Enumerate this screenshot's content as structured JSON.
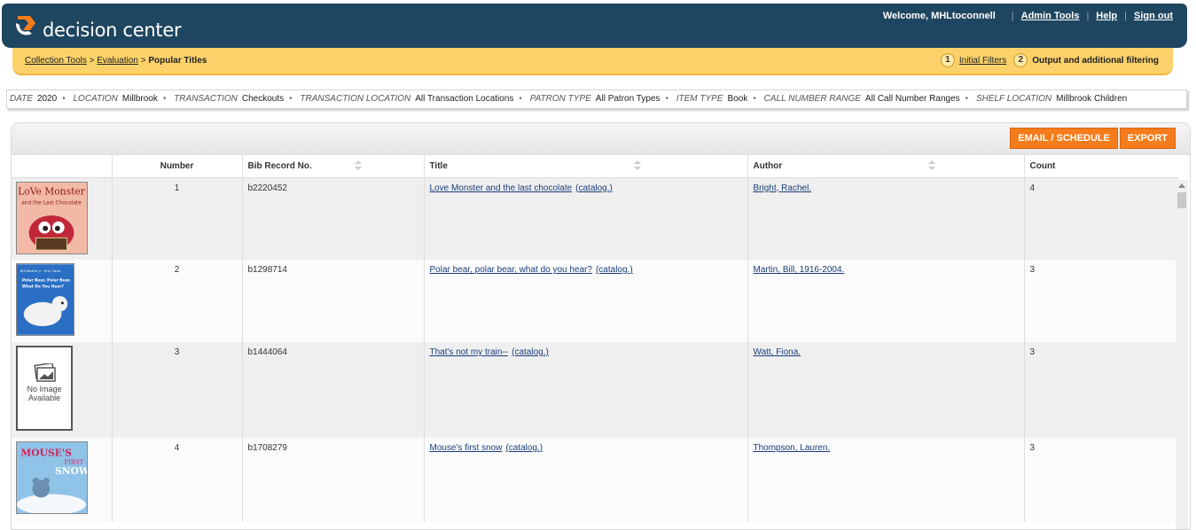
{
  "header": {
    "brand": "decision center",
    "welcome": "Welcome, MHLtoconnell",
    "nav": [
      "Admin Tools",
      "Help",
      "Sign out"
    ],
    "colors": {
      "header_bg": "#1f4660",
      "crumb_bg": "#fbd26a",
      "accent": "#f47c1a"
    }
  },
  "breadcrumb": {
    "items": [
      "Collection Tools",
      "Evaluation"
    ],
    "current": "Popular Titles",
    "sep": ">"
  },
  "steps": [
    {
      "num": "1",
      "label": "Initial Filters"
    },
    {
      "num": "2",
      "label": "Output and additional filtering"
    }
  ],
  "filters": [
    {
      "key": "DATE",
      "value": "2020"
    },
    {
      "key": "LOCATION",
      "value": "Millbrook"
    },
    {
      "key": "TRANSACTION",
      "value": "Checkouts"
    },
    {
      "key": "TRANSACTION LOCATION",
      "value": "All Transaction Locations"
    },
    {
      "key": "PATRON TYPE",
      "value": "All Patron Types"
    },
    {
      "key": "ITEM TYPE",
      "value": "Book"
    },
    {
      "key": "CALL NUMBER RANGE",
      "value": "All Call Number Ranges"
    },
    {
      "key": "SHELF LOCATION",
      "value": "Millbrook Children"
    }
  ],
  "actions": {
    "email": "EMAIL / SCHEDULE",
    "export": "EXPORT"
  },
  "table": {
    "columns": [
      "",
      "Number",
      "Bib Record No.",
      "Title",
      "Author",
      "Count"
    ],
    "catalog_label": "(catalog.)",
    "no_image": [
      "No Image",
      "Available"
    ],
    "rows": [
      {
        "number": "1",
        "bib": "b2220452",
        "title": "Love Monster and the last chocolate",
        "author": "Bright, Rachel.",
        "count": "4",
        "cover": "love-monster"
      },
      {
        "number": "2",
        "bib": "b1298714",
        "title": "Polar bear, polar bear, what do you hear?",
        "author": "Martin, Bill, 1916-2004.",
        "count": "3",
        "cover": "polar-bear"
      },
      {
        "number": "3",
        "bib": "b1444064",
        "title": "That's not my train--",
        "author": "Watt, Fiona.",
        "count": "3",
        "cover": "none"
      },
      {
        "number": "4",
        "bib": "b1708279",
        "title": "Mouse's first snow",
        "author": "Thompson, Lauren.",
        "count": "3",
        "cover": "mouses-first-snow"
      }
    ]
  },
  "covers": {
    "love_monster": [
      "LoVe Monster",
      "and the Last Chocolate"
    ],
    "polar_bear": [
      "Bill Martin Jr · Eric Carle",
      "Polar Bear, Polar Bear,",
      "What Do You Hear?"
    ],
    "mouses_snow": [
      "MOUSE'S",
      "FIRST",
      "SNOW"
    ]
  }
}
